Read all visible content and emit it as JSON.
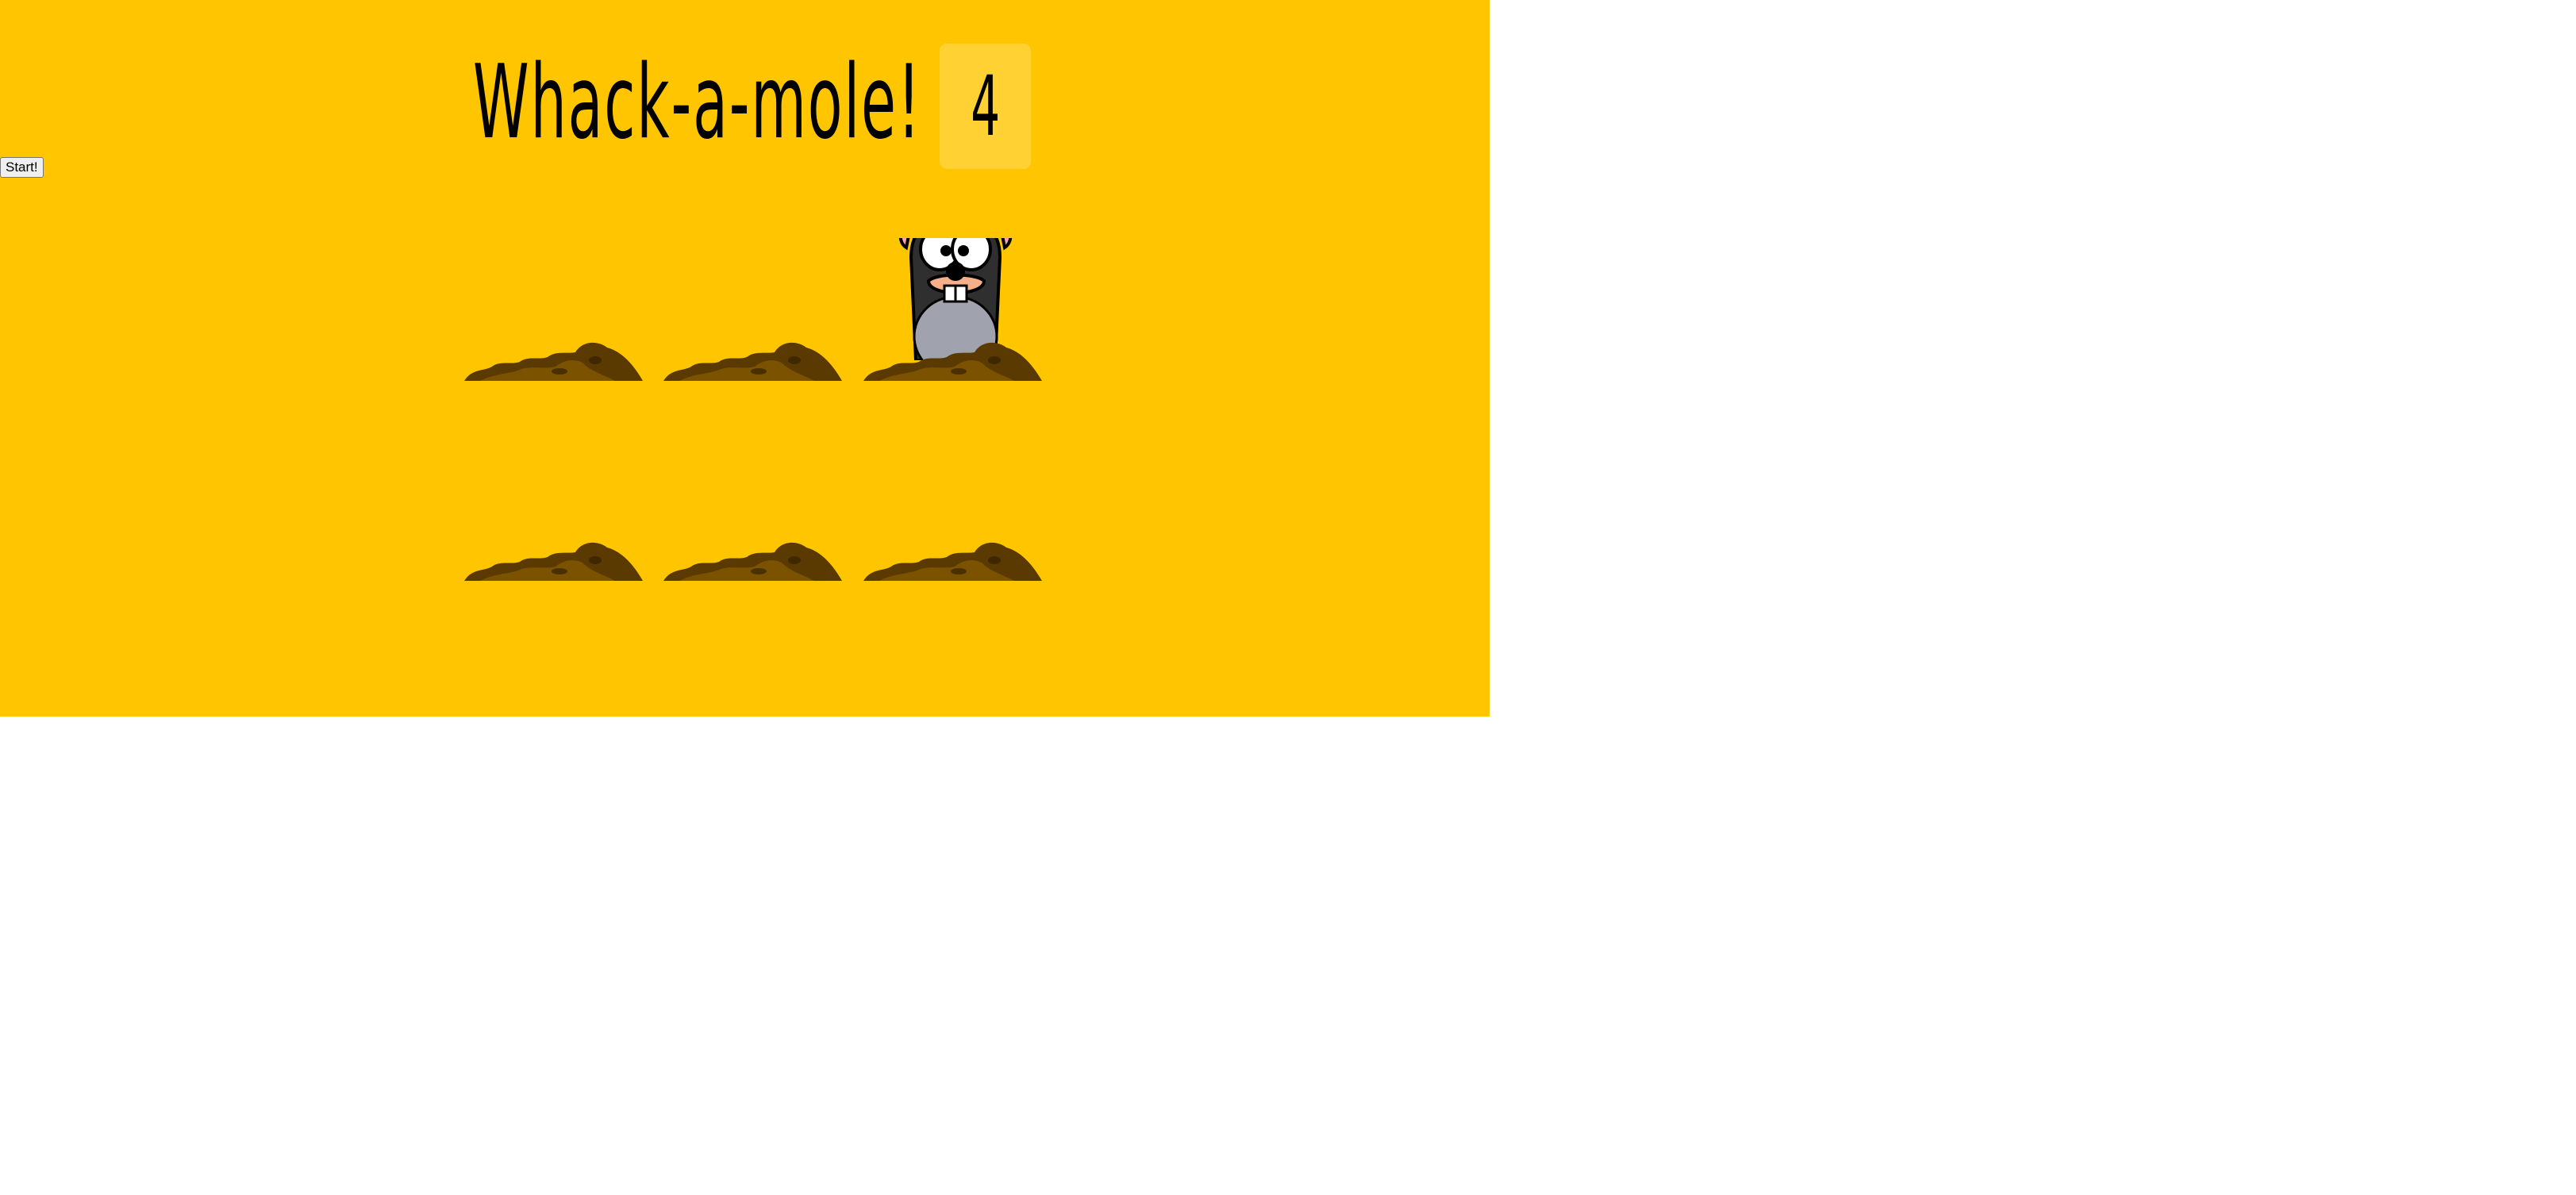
{
  "game": {
    "title": "Whack-a-mole!",
    "score": "4",
    "start_label": "Start!",
    "holes": [
      {
        "label": "hole-1",
        "mole_up": false
      },
      {
        "label": "hole-2",
        "mole_up": false
      },
      {
        "label": "hole-3",
        "mole_up": true
      },
      {
        "label": "hole-4",
        "mole_up": false
      },
      {
        "label": "hole-5",
        "mole_up": false
      },
      {
        "label": "hole-6",
        "mole_up": false
      }
    ]
  },
  "colors": {
    "background": "#ffc600",
    "dirt_dark": "#5a3a00",
    "dirt_mid": "#7a5200",
    "mole_fur": "#2f2f2f"
  }
}
